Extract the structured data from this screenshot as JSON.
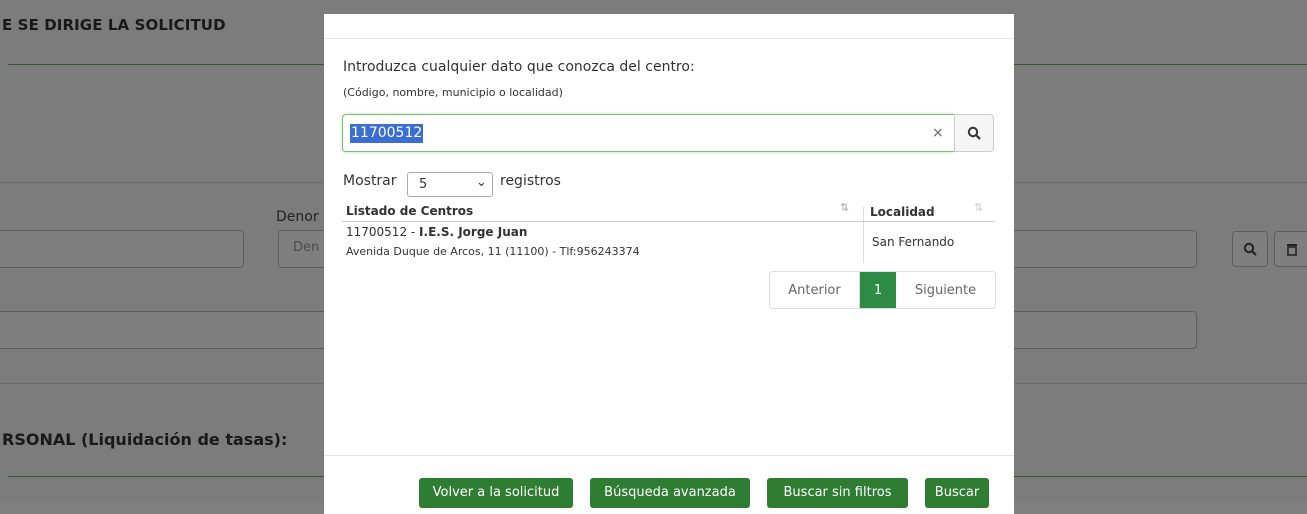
{
  "background": {
    "section_heading": "E SE DIRIGE LA SOLICITUD",
    "denominacion_label": "Denor",
    "denominacion_placeholder": "Den",
    "personal_heading": "RSONAL (Liquidación de tasas):"
  },
  "modal": {
    "intro": "Introduzca cualquier dato que conozca del centro:",
    "hint": "(Código, nombre, municipio o localidad)",
    "search": {
      "value": "11700512",
      "clear": "×"
    },
    "length": {
      "prefix": "Mostrar",
      "value": "5",
      "suffix": "registros"
    },
    "table": {
      "headers": {
        "centros": "Listado de Centros",
        "localidad": "Localidad"
      },
      "rows": [
        {
          "code": "11700512 - ",
          "name": "I.E.S. Jorge Juan",
          "address": "Avenida Duque de Arcos, 11 (11100) - Tlf:956243374",
          "localidad": "San Fernando"
        }
      ]
    },
    "pager": {
      "prev": "Anterior",
      "current": "1",
      "next": "Siguiente"
    },
    "footer": {
      "volver": "Volver a la solicitud",
      "avanzada": "Búsqueda avanzada",
      "sin_filtros": "Buscar sin filtros",
      "buscar": "Buscar"
    }
  },
  "colors": {
    "accent_green": "#2e7d32",
    "pager_active": "#2e8b45",
    "selection_blue": "#3a6ed0"
  }
}
